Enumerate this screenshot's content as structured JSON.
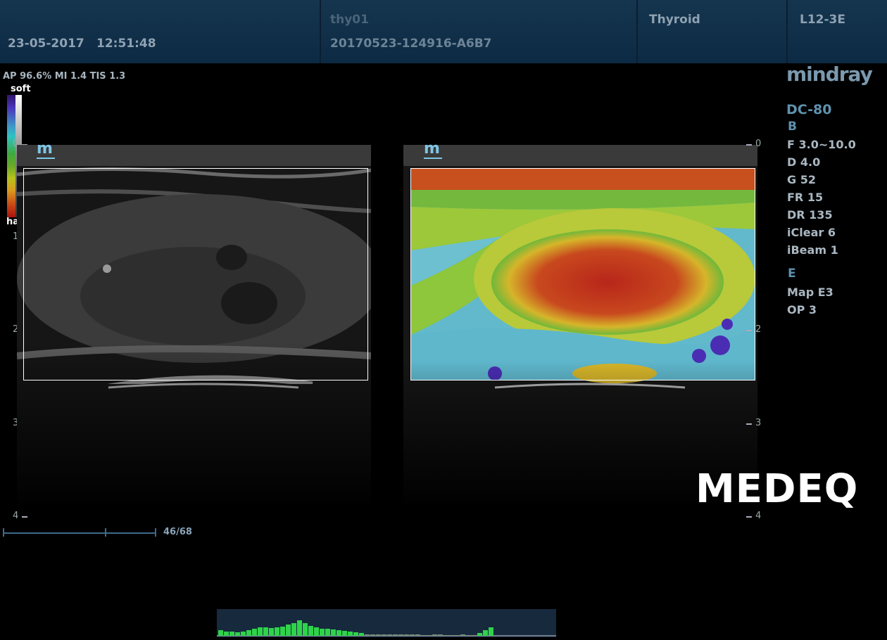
{
  "header": {
    "date": "23-05-2017",
    "time": "12:51:48",
    "patient_id": "thy01",
    "exam_id": "20170523-124916-A6B7",
    "exam_type": "Thyroid",
    "probe": "L12-3E"
  },
  "status": {
    "acoustic_readout": "AP 96.6%  MI 1.4 TIS 1.3"
  },
  "colorbar": {
    "top_label": "soft",
    "bottom_label": "hard"
  },
  "depth_scale": {
    "labels": [
      "0",
      "1",
      "2",
      "3",
      "4"
    ]
  },
  "brand": {
    "logo_text": "mindray",
    "model": "DC-80",
    "image_marker": "m"
  },
  "b_mode": {
    "section": "B",
    "params": [
      "F 3.0~10.0",
      "D 4.0",
      "G 52",
      "FR 15",
      "DR 135",
      "iClear 6",
      "iBeam 1"
    ]
  },
  "elasto": {
    "section": "E",
    "params": [
      "Map E3",
      "OP 3"
    ]
  },
  "cine": {
    "frame_counter": "46/68"
  },
  "watermark": "MEDEQ",
  "histogram": {
    "bars": [
      8,
      6,
      6,
      5,
      6,
      8,
      10,
      12,
      12,
      11,
      12,
      13,
      16,
      18,
      22,
      18,
      14,
      12,
      10,
      10,
      9,
      8,
      7,
      6,
      5,
      4,
      2,
      2,
      2,
      2,
      2,
      2,
      2,
      2,
      2,
      2,
      1,
      1,
      2,
      2,
      1,
      1,
      1,
      2,
      1,
      1,
      4,
      8,
      12,
      0
    ]
  },
  "colors": {
    "header_bg": "#0f2d47",
    "accent_cyan": "#7fc6e6",
    "label_blue": "#5f92ae",
    "histogram_green": "#2fd34a"
  }
}
